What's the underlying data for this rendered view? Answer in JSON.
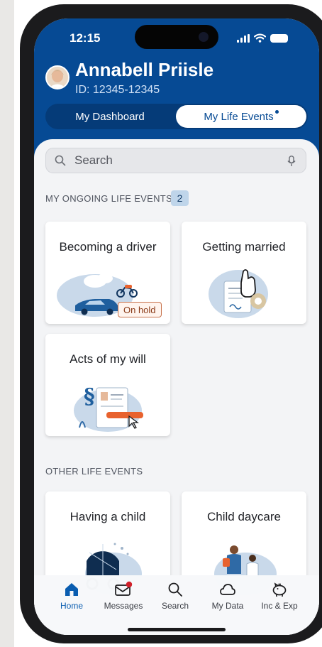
{
  "status_bar": {
    "time": "12:15"
  },
  "user": {
    "name": "Annabell Priisle",
    "id": "ID: 12345-12345"
  },
  "segments": {
    "dashboard": "My Dashboard",
    "life_events": "My Life Events"
  },
  "search": {
    "placeholder": "Search"
  },
  "ongoing": {
    "title": "MY ONGOING LIFE EVENTS",
    "count": "2"
  },
  "ongoing_cards": [
    {
      "title": "Becoming a driver",
      "badge": "On hold"
    },
    {
      "title": "Getting married"
    },
    {
      "title": "Acts of my will"
    }
  ],
  "other": {
    "title": "OTHER LIFE EVENTS"
  },
  "other_cards": [
    {
      "title": "Having a child"
    },
    {
      "title": "Child daycare"
    }
  ],
  "tabbar": [
    {
      "label": "Home",
      "icon": "home-icon",
      "active": true
    },
    {
      "label": "Messages",
      "icon": "mail-icon",
      "active": false
    },
    {
      "label": "Search",
      "icon": "search-icon",
      "active": false
    },
    {
      "label": "My Data",
      "icon": "cloud-icon",
      "active": false
    },
    {
      "label": "Inc & Exp",
      "icon": "piggy-bank-icon",
      "active": false
    }
  ],
  "colors": {
    "header": "#064a94",
    "accent": "#0a5db0",
    "badge": "#bfd5ea",
    "notification": "#d0202a"
  }
}
